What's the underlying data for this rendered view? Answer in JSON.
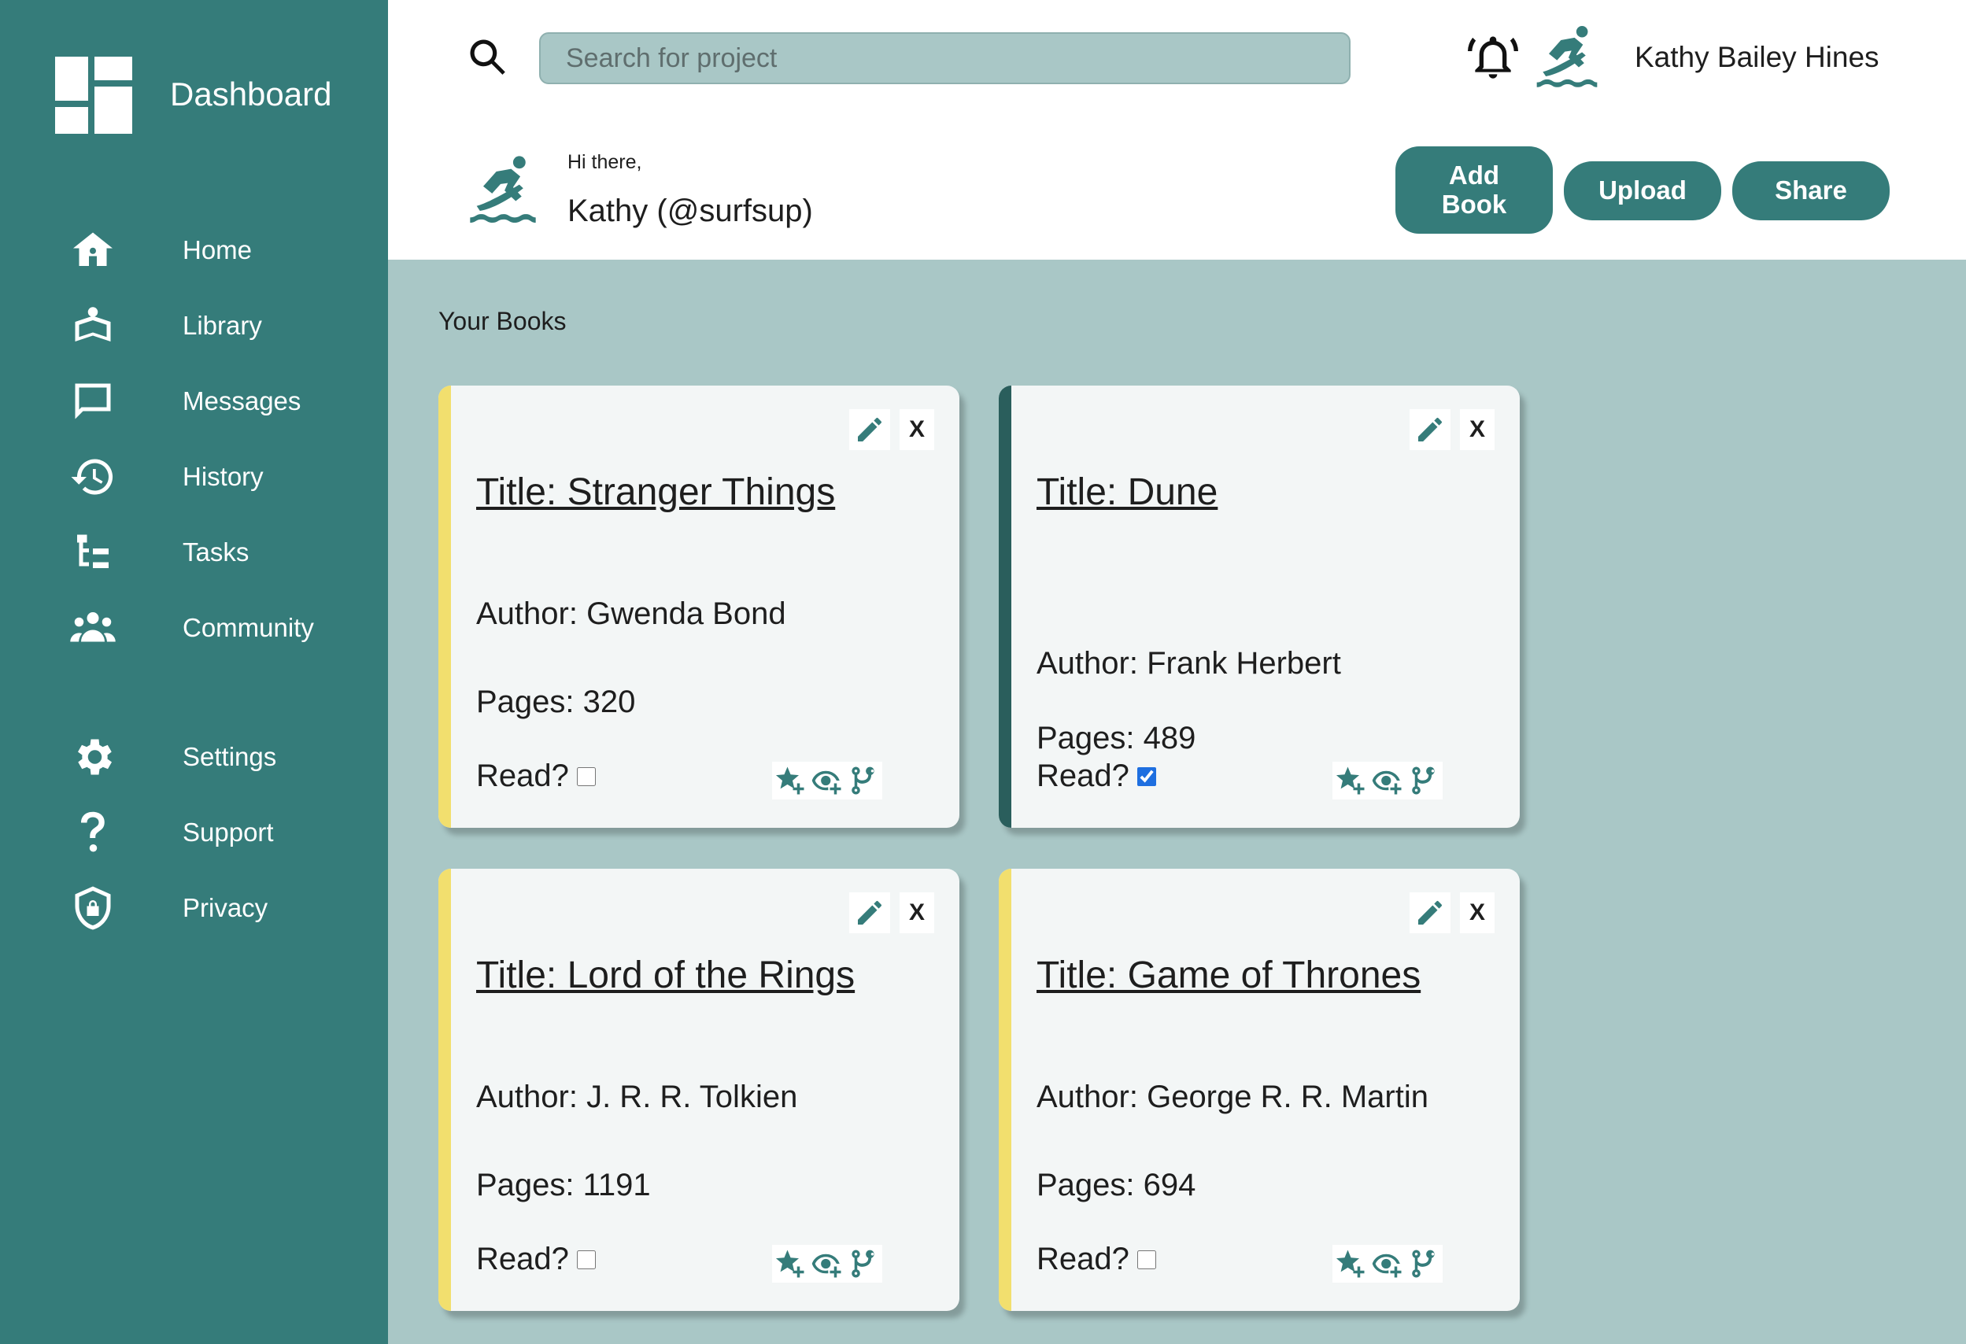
{
  "sidebar": {
    "title": "Dashboard",
    "items": [
      {
        "label": "Home",
        "icon": "home-icon"
      },
      {
        "label": "Library",
        "icon": "library-icon"
      },
      {
        "label": "Messages",
        "icon": "messages-icon"
      },
      {
        "label": "History",
        "icon": "history-icon"
      },
      {
        "label": "Tasks",
        "icon": "tasks-icon"
      },
      {
        "label": "Community",
        "icon": "community-icon"
      },
      {
        "label": "Settings",
        "icon": "gear-icon"
      },
      {
        "label": "Support",
        "icon": "question-icon"
      },
      {
        "label": "Privacy",
        "icon": "shield-icon"
      }
    ]
  },
  "header": {
    "search_placeholder": "Search for project",
    "user_name": "Kathy Bailey Hines",
    "greeting": "Hi there,",
    "handle": "Kathy (@surfsup)",
    "buttons": {
      "add_line1": "Add",
      "add_line2": "Book",
      "upload": "Upload",
      "share": "Share"
    }
  },
  "main": {
    "section_title": "Your Books",
    "books": [
      {
        "title": "Title: Stranger Things",
        "author": "Author: Gwenda Bond",
        "pages": "Pages: 320",
        "read_label": "Read?",
        "read": false,
        "accent": "#f2df6e",
        "close": "X"
      },
      {
        "title": "Title: Dune",
        "author": "Author: Frank Herbert",
        "pages": "Pages: 489",
        "read_label": "Read?",
        "read": true,
        "accent": "#2a5e5c",
        "close": "X"
      },
      {
        "title": "Title: Lord of the Rings",
        "author": "Author: J. R. R. Tolkien",
        "pages": "Pages: 1191",
        "read_label": "Read?",
        "read": false,
        "accent": "#f2df6e",
        "close": "X"
      },
      {
        "title": "Title: Game of Thrones",
        "author": "Author: George R. R. Martin",
        "pages": "Pages: 694",
        "read_label": "Read?",
        "read": false,
        "accent": "#f2df6e",
        "close": "X"
      }
    ]
  },
  "colors": {
    "primary": "#357c7a",
    "background": "#a9c7c6",
    "accent_yellow": "#f2df6e",
    "accent_dark": "#2a5e5c"
  }
}
